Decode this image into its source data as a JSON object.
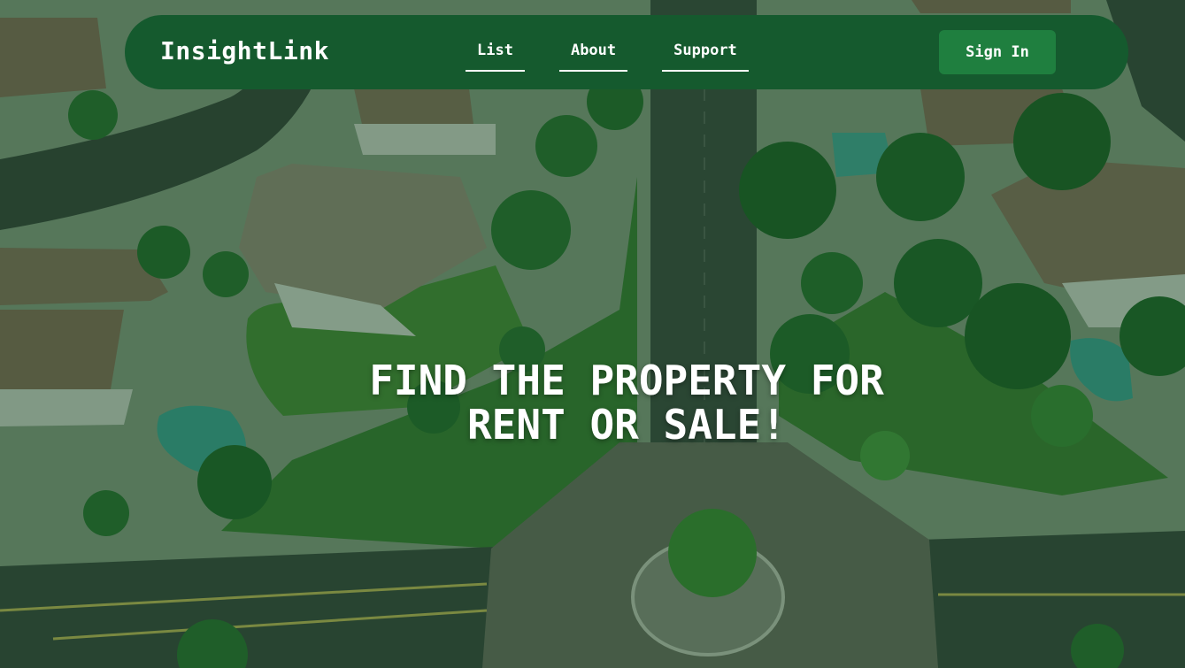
{
  "brand": {
    "name": "InsightLink"
  },
  "nav": {
    "links": [
      {
        "label": "List"
      },
      {
        "label": "About"
      },
      {
        "label": "Support"
      }
    ],
    "signin_label": "Sign In"
  },
  "hero": {
    "headline_line1": "FIND THE PROPERTY FOR",
    "headline_line2": "RENT OR SALE!",
    "background": "aerial-neighborhood-photo"
  },
  "colors": {
    "navbar": "#155a2e",
    "button": "#1f7f3f",
    "overlay": "#0e481e",
    "text": "#ffffff"
  }
}
